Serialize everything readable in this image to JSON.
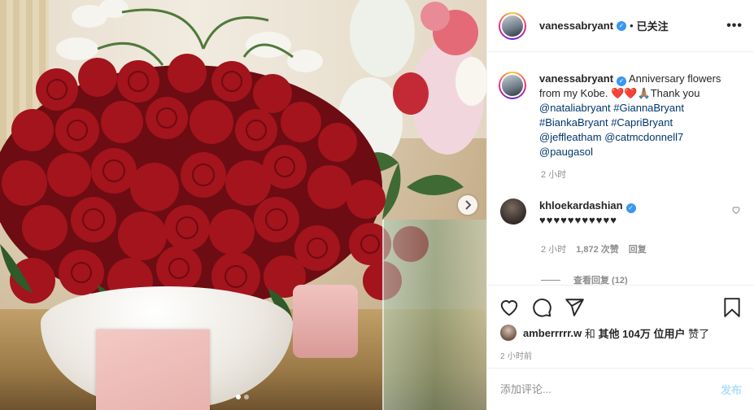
{
  "post": {
    "photo_alt": "",
    "carousel": {
      "slide_count": 2,
      "active_index": 0
    }
  },
  "header": {
    "username": "vanessabryant",
    "separator": "•",
    "follow_state": "已关注",
    "more": "•••"
  },
  "caption": {
    "username": "vanessabryant",
    "text_before": "Anniversary flowers from my Kobe.",
    "emoji": "❤️❤️🙏🏽",
    "text_after": "Thank you",
    "mentions": [
      "@nataliabryant",
      "#GiannaBryant",
      "#BiankaBryant",
      "#CapriBryant",
      "@jeffleatham",
      "@catmcdonnell7",
      "@paugasol"
    ],
    "time": "2 小时"
  },
  "comment": {
    "username": "khloekardashian",
    "text": "♥♥♥♥♥♥♥♥♥♥♥",
    "time": "2 小时",
    "likes": "1,872 次赞",
    "reply": "回复",
    "view_replies": "查看回复 (12)"
  },
  "likes": {
    "user": "amberrrrr.w",
    "and": "和",
    "others": "其他 104万 位用户",
    "suffix": "赞了"
  },
  "post_time": "2 小时前",
  "composer": {
    "placeholder": "添加评论...",
    "post_label": "发布"
  },
  "colors": {
    "link": "#00376b",
    "verified": "#3897f0",
    "post_disabled": "#b2dffc",
    "muted": "#8e8e8e"
  }
}
